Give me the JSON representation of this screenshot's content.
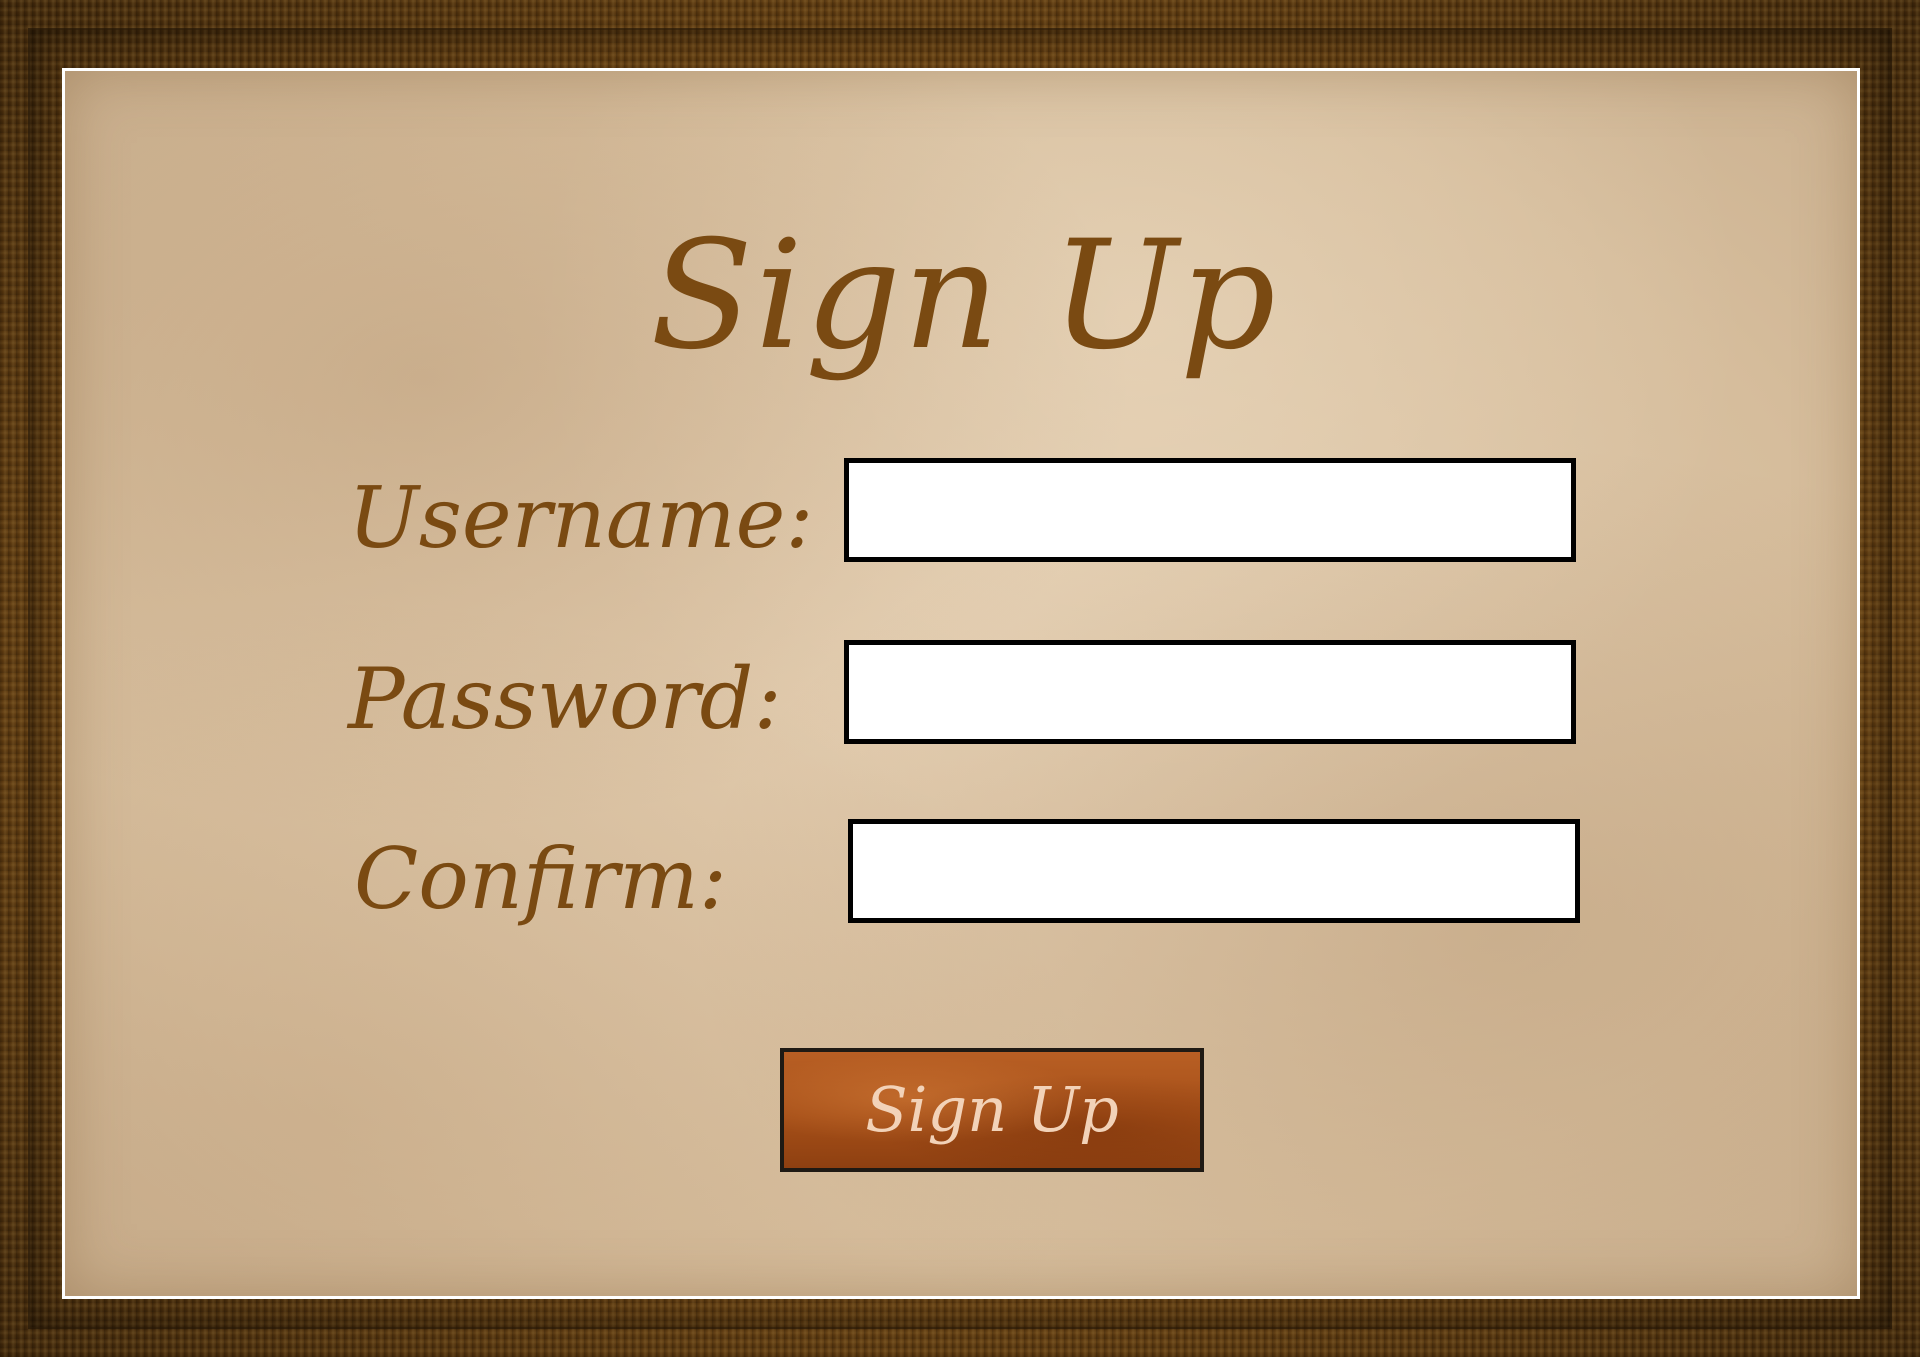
{
  "form": {
    "title": "Sign Up",
    "fields": [
      {
        "label": "Username:",
        "value": "",
        "placeholder": ""
      },
      {
        "label": "Password:",
        "value": "",
        "placeholder": ""
      },
      {
        "label": "Confirm:",
        "value": "",
        "placeholder": ""
      }
    ],
    "submit_label": "Sign Up"
  },
  "colors": {
    "frame_wood": "#6a4212",
    "paper": "#d6bd9c",
    "text_brown": "#7a4a12",
    "button_orange": "#a64f18",
    "button_text": "#f2d2b8",
    "field_border": "#000000",
    "field_bg": "#ffffff"
  }
}
